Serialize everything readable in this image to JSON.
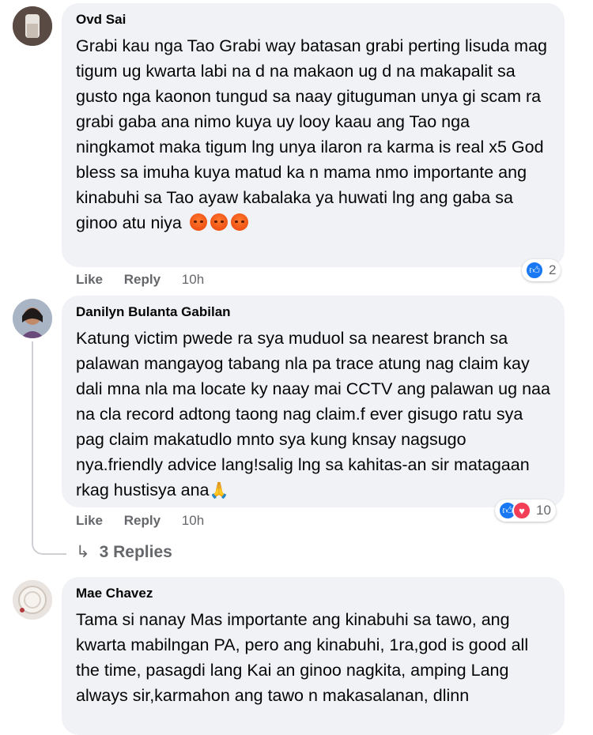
{
  "comments": [
    {
      "author": "Ovd Sai",
      "text": "Grabi kau nga Tao Grabi way batasan grabi perting lisuda mag tigum ug kwarta labi na d na makaon ug d na makapalit sa gusto nga kaonon tungud sa naay gituguman unya gi scam ra grabi gaba ana nimo kuya uy looy kaau ang Tao nga ningkamot maka tigum lng unya ilaron ra karma is real x5 God bless sa imuha kuya matud ka n mama nmo importante ang kinabuhi sa Tao ayaw kabalaka ya huwati lng ang gaba sa ginoo atu niya",
      "like_label": "Like",
      "reply_label": "Reply",
      "time": "10h",
      "reaction_count": "2",
      "emoji_icon": "angry-emoji-icon"
    },
    {
      "author": "Danilyn Bulanta Gabilan",
      "text": "Katung victim pwede ra sya muduol sa nearest branch sa palawan mangayog tabang nla pa trace atung nag claim kay dali mna nla ma locate ky naay mai CCTV ang palawan ug naa na cla record adtong taong nag claim.f ever gisugo ratu sya pag claim makatudlo mnto sya kung knsay nagsugo nya.friendly advice lang!salig lng sa kahitas-an sir matagaan rkag hustisya ana",
      "like_label": "Like",
      "reply_label": "Reply",
      "time": "10h",
      "reaction_count": "10",
      "emoji_icon": "praying-hands-icon",
      "replies_label": "3 Replies"
    },
    {
      "author": "Mae Chavez",
      "text": "Tama si nanay Mas importante ang kinabuhi sa tawo, ang kwarta mabilngan PA, pero ang kinabuhi, 1ra,god is good all the time, pasagdi lang Kai an ginoo nagkita, amping Lang always sir,karmahon ang tawo n makasalanan, dlinn"
    }
  ],
  "colors": {
    "bubble": "#f0f2f5",
    "secondary_text": "#65676b",
    "like_blue": "#1877f2",
    "love_red": "#f33e58"
  }
}
